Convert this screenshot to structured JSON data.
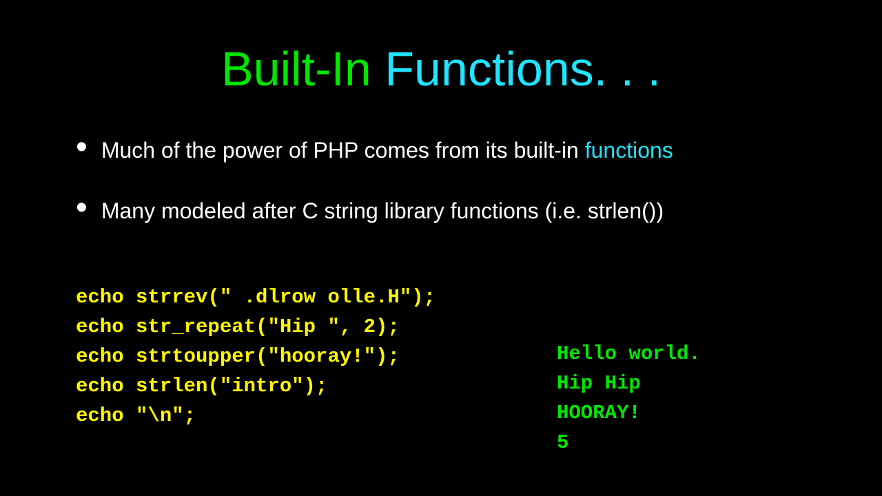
{
  "title": {
    "part1": "Built-In",
    "part2": " Functions. . ."
  },
  "bullet1": {
    "prefix": "Much of the power of PHP comes from its built-in ",
    "linkword": "functions"
  },
  "bullet2": {
    "text": "Many modeled after C string library functions (i.e. strlen())"
  },
  "code": {
    "line1": "echo strrev(\" .dlrow olle.H\");",
    "line2": "echo str_repeat(\"Hip \", 2);",
    "line3": "echo strtoupper(\"hooray!\");",
    "line4": "echo strlen(\"intro\");",
    "line5": "echo \"\\n\";"
  },
  "output": {
    "line1": "Hello world.",
    "line2": "Hip Hip",
    "line3": "HOORAY!",
    "line4": "5"
  }
}
